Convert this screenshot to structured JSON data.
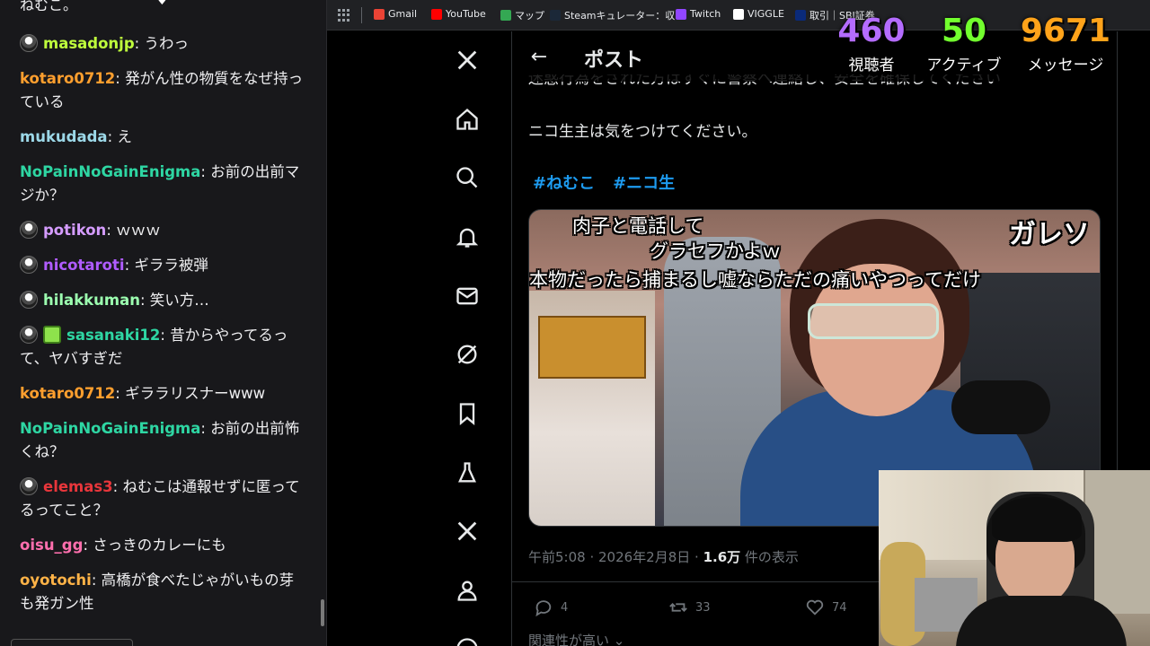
{
  "chat": {
    "clipped_top": "ねむこ。",
    "messages": [
      {
        "user": "masadonjp",
        "text": "うわっ",
        "color": "#bfff3c",
        "badge": "owl"
      },
      {
        "user": "kotaro0712",
        "text": "発がん性の物質をなぜ持っている",
        "color": "#ff9f2e",
        "badge": ""
      },
      {
        "user": "mukudada",
        "text": "え",
        "color": "#9cd8e8",
        "badge": ""
      },
      {
        "user": "NoPainNoGainEnigma",
        "text": "お前の出前マジか？",
        "color": "#2ed6a3",
        "badge": ""
      },
      {
        "user": "potikon",
        "text": "ｗｗｗ",
        "color": "#d59cff",
        "badge": "owl"
      },
      {
        "user": "nicotaroti",
        "text": "ギララ被弾",
        "color": "#b05cff",
        "badge": "owl"
      },
      {
        "user": "hilakkuman",
        "text": "笑い方…",
        "color": "#9cffb0",
        "badge": "owl"
      },
      {
        "user": "sasanaki12",
        "text": "昔からやってるって、ヤバすぎだ",
        "color": "#2ed6a3",
        "badge": "owl+gift"
      },
      {
        "user": "kotaro0712",
        "text": "ギララリスナーwww",
        "color": "#ff9f2e",
        "badge": ""
      },
      {
        "user": "NoPainNoGainEnigma",
        "text": "お前の出前怖くね？",
        "color": "#2ed6a3",
        "badge": ""
      },
      {
        "user": "elemas3",
        "text": "ねむこは通報せずに匿ってるってこと？",
        "color": "#e8363b",
        "badge": "owl"
      },
      {
        "user": "oisu_gg",
        "text": "さっきのカレーにも",
        "color": "#ff6fae",
        "badge": ""
      },
      {
        "user": "oyotochi",
        "text": "高橋が食べたじゃがいもの芽も発ガン性",
        "color": "#ffb347",
        "badge": ""
      }
    ]
  },
  "bookmarks": [
    {
      "label": "Gmail",
      "color": "#ea4335"
    },
    {
      "label": "YouTube",
      "color": "#ff0000"
    },
    {
      "label": "マップ",
      "color": "#34a853"
    },
    {
      "label": "Steamキュレーター：収…",
      "color": "#1b2838"
    },
    {
      "label": "Twitch",
      "color": "#9146ff"
    },
    {
      "label": "VIGGLE",
      "color": "#ffffff"
    },
    {
      "label": "取引｜SBI証券",
      "color": "#0a2a7a"
    }
  ],
  "stats": [
    {
      "value": "460",
      "label": "視聴者",
      "color": "#b46cff"
    },
    {
      "value": "50",
      "label": "アクティブ",
      "color": "#72ff2e"
    },
    {
      "value": "9671",
      "label": "メッセージ",
      "color": "#ffa31a"
    }
  ],
  "x": {
    "header_title": "ポスト",
    "clipped_line": "迷惑行為をされた方はすぐに警察へ連絡し、安全を確保してください",
    "body": "ニコ生主は気をつけてください。",
    "hashtags": [
      "#ねむこ",
      "#ニコ生"
    ],
    "captions": {
      "line1": "肉子と電話して",
      "line2": "グラセフかよｗ",
      "line3": "本物だったら捕まるし嘘ならただの痛いやつってだけ",
      "corner": "ガレソ"
    },
    "meta_prefix": "午前5:08 · 2026年2月8日 · ",
    "meta_views": "1.6万",
    "meta_suffix": " 件の表示",
    "replies": "4",
    "reposts": "33",
    "likes": "74",
    "related": "関連性が高い"
  }
}
